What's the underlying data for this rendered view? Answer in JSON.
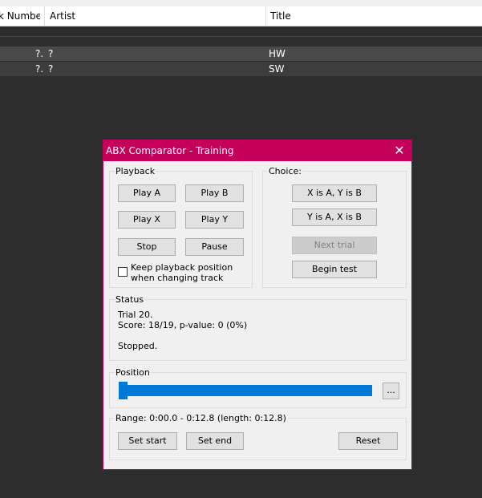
{
  "playlist": {
    "columns": [
      "k Number",
      "Artist",
      "Title"
    ],
    "rows": [
      {
        "number": "?.",
        "artist": "?",
        "title": "HW"
      },
      {
        "number": "?.",
        "artist": "?",
        "title": "SW"
      }
    ]
  },
  "dialog": {
    "title": "ABX Comparator - Training",
    "close_icon": "close-icon",
    "playback": {
      "label": "Playback",
      "play_a": "Play A",
      "play_b": "Play B",
      "play_x": "Play X",
      "play_y": "Play Y",
      "stop": "Stop",
      "pause": "Pause",
      "keep_position_label": "Keep playback position when changing track",
      "keep_position_checked": false
    },
    "choice": {
      "label": "Choice:",
      "x_is_a": "X is A, Y is B",
      "y_is_a": "Y is A, X is B",
      "next_trial": "Next trial",
      "begin_test": "Begin test"
    },
    "status": {
      "label": "Status",
      "trial": "Trial 20.",
      "score": "Score: 18/19, p-value: 0 (0%)",
      "state": "Stopped."
    },
    "position": {
      "label": "Position",
      "browse": "...",
      "fraction": 0.0
    },
    "range": {
      "label": "Range: 0:00.0 - 0:12.8 (length: 0:12.8)",
      "set_start": "Set start",
      "set_end": "Set end",
      "reset": "Reset"
    }
  },
  "colors": {
    "accent": "#c4005a",
    "slider": "#0078d7",
    "background": "#2d2d2d"
  }
}
